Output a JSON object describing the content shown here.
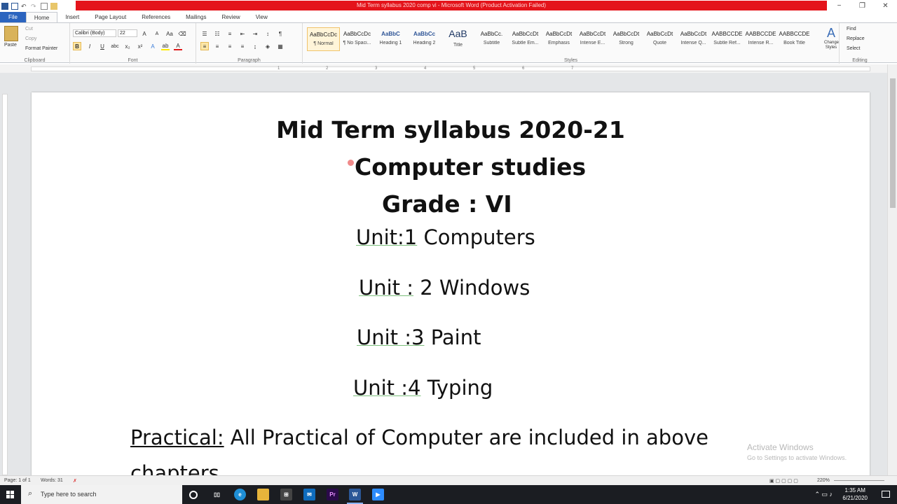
{
  "window": {
    "title": "Mid Term syllabus 2020 comp vi - Microsoft Word (Product Activation Failed)",
    "minimize": "−",
    "maximize": "❐",
    "close": "✕"
  },
  "tabs": [
    "File",
    "Home",
    "Insert",
    "Page Layout",
    "References",
    "Mailings",
    "Review",
    "View"
  ],
  "ribbon": {
    "clipboard": {
      "paste": "Paste",
      "cut": "Cut",
      "copy": "Copy",
      "format_painter": "Format Painter",
      "label": "Clipboard"
    },
    "font": {
      "name": "Calibri (Body)",
      "size": "22",
      "label": "Font"
    },
    "paragraph": {
      "label": "Paragraph"
    },
    "styles": {
      "label": "Styles",
      "items": [
        {
          "sample": "AaBbCcDc",
          "name": "¶ Normal"
        },
        {
          "sample": "AaBbCcDc",
          "name": "¶ No Spaci..."
        },
        {
          "sample": "AaBbC",
          "name": "Heading 1"
        },
        {
          "sample": "AaBbCc",
          "name": "Heading 2"
        },
        {
          "sample": "AaB",
          "name": "Title"
        },
        {
          "sample": "AaBbCc.",
          "name": "Subtitle"
        },
        {
          "sample": "AaBbCcDt",
          "name": "Subtle Em..."
        },
        {
          "sample": "AaBbCcDt",
          "name": "Emphasis"
        },
        {
          "sample": "AaBbCcDt",
          "name": "Intense E..."
        },
        {
          "sample": "AaBbCcDt",
          "name": "Strong"
        },
        {
          "sample": "AaBbCcDt",
          "name": "Quote"
        },
        {
          "sample": "AaBbCcDt",
          "name": "Intense Q..."
        },
        {
          "sample": "AABBCCDE",
          "name": "Subtle Ref..."
        },
        {
          "sample": "AABBCCDE",
          "name": "Intense R..."
        },
        {
          "sample": "AABBCCDE",
          "name": "Book Title"
        }
      ],
      "change_styles": "Change Styles"
    },
    "editing": {
      "find": "Find",
      "replace": "Replace",
      "select": "Select",
      "label": "Editing"
    }
  },
  "ruler_numbers": [
    "1",
    "2",
    "3",
    "4",
    "5",
    "6",
    "7"
  ],
  "document": {
    "line1": "Mid Term syllabus 2020-21",
    "line2": "Computer studies",
    "line3": "Grade : VI",
    "unit1_a": "Unit:1",
    "unit1_b": " Computers",
    "unit2_a": "Unit :",
    "unit2_b": " 2 Windows",
    "unit3_a": "Unit :3",
    "unit3_b": " Paint",
    "unit4_a": "Unit :4",
    "unit4_b": " Typing",
    "practical_label": "Practical:",
    "practical_text": " All Practical of Computer are included in above",
    "practical_cont": "chapters"
  },
  "watermark": {
    "line1": "Activate Windows",
    "line2": "Go to Settings to activate Windows."
  },
  "status": {
    "page": "Page: 1 of 1",
    "words": "Words: 31",
    "zoom": "220%"
  },
  "taskbar": {
    "search_placeholder": "Type here to search",
    "time": "1:35 AM",
    "date": "6/21/2020"
  }
}
